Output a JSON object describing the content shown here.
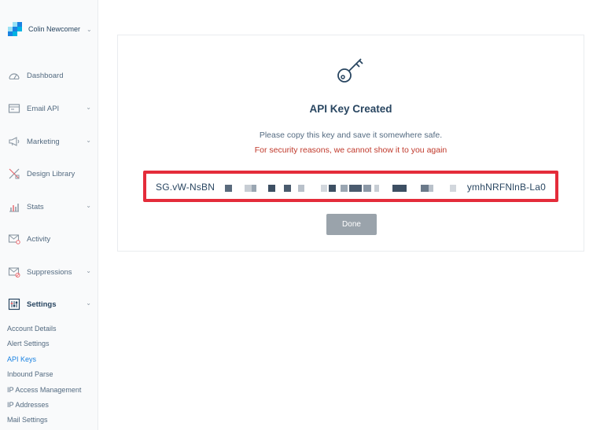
{
  "sidebar": {
    "account_name": "Colin Newcomer",
    "account_chevron": "⌄",
    "items": [
      {
        "label": "Dashboard",
        "icon": "dashboard-icon",
        "chevron": ""
      },
      {
        "label": "Email API",
        "icon": "email-api-icon",
        "chevron": "⌄"
      },
      {
        "label": "Marketing",
        "icon": "megaphone-icon",
        "chevron": "⌄"
      },
      {
        "label": "Design Library",
        "icon": "design-library-icon",
        "chevron": ""
      },
      {
        "label": "Stats",
        "icon": "stats-icon",
        "chevron": "⌄"
      },
      {
        "label": "Activity",
        "icon": "activity-icon",
        "chevron": ""
      },
      {
        "label": "Suppressions",
        "icon": "suppressions-icon",
        "chevron": "⌄"
      },
      {
        "label": "Settings",
        "icon": "settings-icon",
        "chevron": "⌄"
      }
    ],
    "sub_items": [
      {
        "label": "Account Details",
        "active": false
      },
      {
        "label": "Alert Settings",
        "active": false
      },
      {
        "label": "API Keys",
        "active": true
      },
      {
        "label": "Inbound Parse",
        "active": false
      },
      {
        "label": "IP Access Management",
        "active": false
      },
      {
        "label": "IP Addresses",
        "active": false
      },
      {
        "label": "Mail Settings",
        "active": false
      }
    ]
  },
  "main": {
    "title": "API Key Created",
    "instruction": "Please copy this key and save it somewhere safe.",
    "warning": "For security reasons, we cannot show it to you again",
    "key_prefix": "SG.vW-NsBN",
    "key_suffix": "ymhNRFNlnB-La0",
    "done_label": "Done"
  },
  "colors": {
    "highlight_border": "#e42c3a",
    "active_link": "#1a82e2",
    "warning_text": "#c0392b",
    "done_button": "#9aa3ab"
  }
}
